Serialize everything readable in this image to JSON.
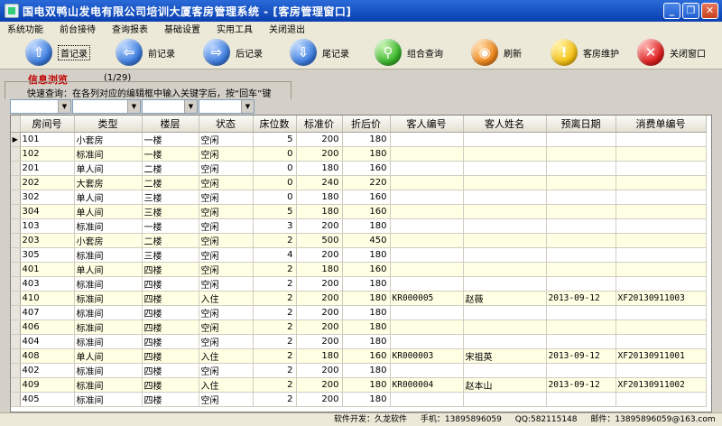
{
  "window": {
    "title": "国电双鸭山发电有限公司培训大厦客房管理系统 - [客房管理窗口]",
    "minimize_glyph": "_",
    "restore_glyph": "❐",
    "close_glyph": "✕"
  },
  "menu": [
    "系统功能",
    "前台接待",
    "查询报表",
    "基础设置",
    "实用工具",
    "关闭退出"
  ],
  "toolbar": {
    "first": "首记录",
    "prev": "前记录",
    "next": "后记录",
    "last": "尾记录",
    "query": "组合查询",
    "refresh": "刷新",
    "maintain": "客房维护",
    "close": "关闭窗口"
  },
  "info": {
    "title": "信息浏览",
    "count": "(1/29)",
    "hint": "快速查询：在各列对应的编辑框中输入关键字后，按“回车”键"
  },
  "grid": {
    "columns": [
      "房间号",
      "类型",
      "楼层",
      "状态",
      "床位数",
      "标准价",
      "折后价",
      "客人编号",
      "客人姓名",
      "预离日期",
      "消费单编号"
    ],
    "rows": [
      [
        "101",
        "小套房",
        "一楼",
        "空闲",
        "5",
        "200",
        "180",
        "",
        "",
        "",
        ""
      ],
      [
        "102",
        "标准间",
        "一楼",
        "空闲",
        "0",
        "200",
        "180",
        "",
        "",
        "",
        ""
      ],
      [
        "201",
        "单人间",
        "二楼",
        "空闲",
        "0",
        "180",
        "160",
        "",
        "",
        "",
        ""
      ],
      [
        "202",
        "大套房",
        "二楼",
        "空闲",
        "0",
        "240",
        "220",
        "",
        "",
        "",
        ""
      ],
      [
        "302",
        "单人间",
        "三楼",
        "空闲",
        "0",
        "180",
        "160",
        "",
        "",
        "",
        ""
      ],
      [
        "304",
        "单人间",
        "三楼",
        "空闲",
        "5",
        "180",
        "160",
        "",
        "",
        "",
        ""
      ],
      [
        "103",
        "标准间",
        "一楼",
        "空闲",
        "3",
        "200",
        "180",
        "",
        "",
        "",
        ""
      ],
      [
        "203",
        "小套房",
        "二楼",
        "空闲",
        "2",
        "500",
        "450",
        "",
        "",
        "",
        ""
      ],
      [
        "305",
        "标准间",
        "三楼",
        "空闲",
        "4",
        "200",
        "180",
        "",
        "",
        "",
        ""
      ],
      [
        "401",
        "单人间",
        "四楼",
        "空闲",
        "2",
        "180",
        "160",
        "",
        "",
        "",
        ""
      ],
      [
        "403",
        "标准间",
        "四楼",
        "空闲",
        "2",
        "200",
        "180",
        "",
        "",
        "",
        ""
      ],
      [
        "410",
        "标准间",
        "四楼",
        "入住",
        "2",
        "200",
        "180",
        "KR000005",
        "赵薇",
        "2013-09-12",
        "XF20130911003"
      ],
      [
        "407",
        "标准间",
        "四楼",
        "空闲",
        "2",
        "200",
        "180",
        "",
        "",
        "",
        ""
      ],
      [
        "406",
        "标准间",
        "四楼",
        "空闲",
        "2",
        "200",
        "180",
        "",
        "",
        "",
        ""
      ],
      [
        "404",
        "标准间",
        "四楼",
        "空闲",
        "2",
        "200",
        "180",
        "",
        "",
        "",
        ""
      ],
      [
        "408",
        "单人间",
        "四楼",
        "入住",
        "2",
        "180",
        "160",
        "KR000003",
        "宋祖英",
        "2013-09-12",
        "XF20130911001"
      ],
      [
        "402",
        "标准间",
        "四楼",
        "空闲",
        "2",
        "200",
        "180",
        "",
        "",
        "",
        ""
      ],
      [
        "409",
        "标准间",
        "四楼",
        "入住",
        "2",
        "200",
        "180",
        "KR000004",
        "赵本山",
        "2013-09-12",
        "XF20130911002"
      ],
      [
        "405",
        "标准间",
        "四楼",
        "空闲",
        "2",
        "200",
        "180",
        "",
        "",
        "",
        ""
      ]
    ],
    "current_row_marker": "▶"
  },
  "status": {
    "developer": "软件开发：久龙软件",
    "phone": "手机：13895896059",
    "qq": "QQ:582115148",
    "email": "邮件：13895896059@163.com"
  }
}
